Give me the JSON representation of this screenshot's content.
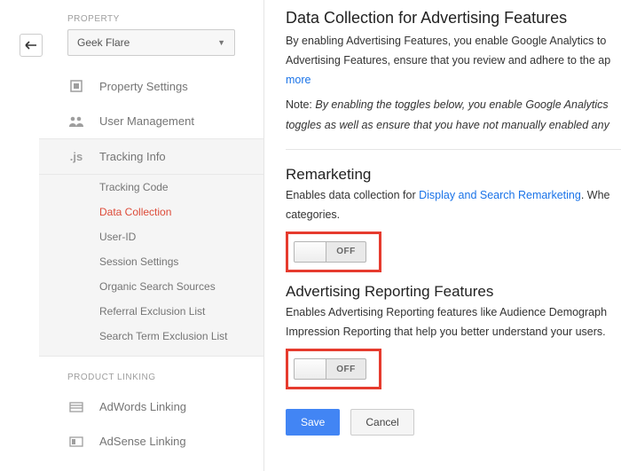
{
  "back_arrow": "↩",
  "sidebar": {
    "property_label": "PROPERTY",
    "property_value": "Geek Flare",
    "items": [
      {
        "label": "Property Settings"
      },
      {
        "label": "User Management"
      },
      {
        "label": "Tracking Info"
      }
    ],
    "tracking_sub": [
      "Tracking Code",
      "Data Collection",
      "User-ID",
      "Session Settings",
      "Organic Search Sources",
      "Referral Exclusion List",
      "Search Term Exclusion List"
    ],
    "product_linking_label": "PRODUCT LINKING",
    "linking": [
      "AdWords Linking",
      "AdSense Linking"
    ]
  },
  "content": {
    "h1": "Data Collection for Advertising Features",
    "p1a": "By enabling Advertising Features, you enable Google Analytics to ",
    "p1b": "Advertising Features, ensure that you review and adhere to the ap",
    "more": "more",
    "note_label": "Note: ",
    "note1": "By enabling the toggles below, you enable Google Analytics ",
    "note2": "toggles as well as ensure that you have not manually enabled any",
    "remarketing": {
      "title": "Remarketing",
      "desc_a": "Enables data collection for ",
      "link": "Display and Search Remarketing",
      "desc_b": ". Whe",
      "desc2": "categories.",
      "toggle": "OFF"
    },
    "arf": {
      "title": "Advertising Reporting Features",
      "desc1": "Enables Advertising Reporting features like Audience Demograph",
      "desc2": "Impression Reporting that help you better understand your users.",
      "toggle": "OFF"
    },
    "save": "Save",
    "cancel": "Cancel"
  }
}
